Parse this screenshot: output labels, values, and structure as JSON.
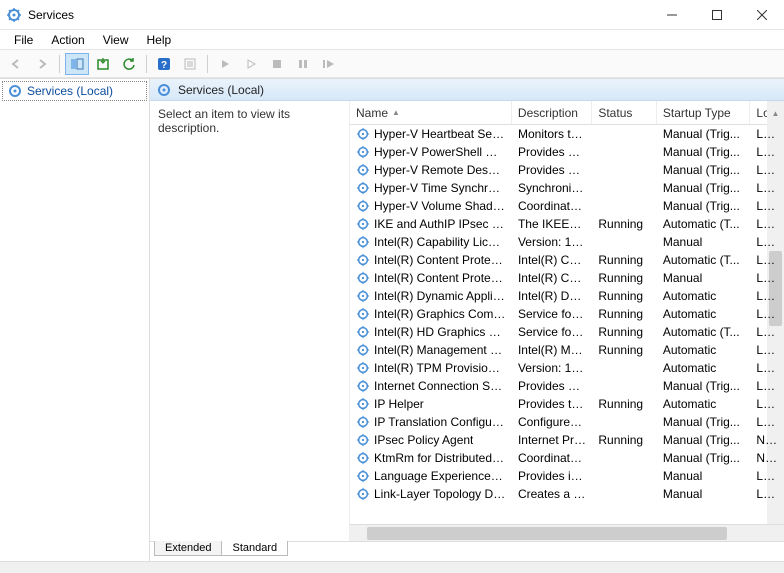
{
  "window": {
    "title": "Services"
  },
  "menu": {
    "file": "File",
    "action": "Action",
    "view": "View",
    "help": "Help"
  },
  "tree": {
    "root": "Services (Local)"
  },
  "pane": {
    "heading": "Services (Local)",
    "hint": "Select an item to view its description."
  },
  "columns": {
    "name": "Name",
    "description": "Description",
    "status": "Status",
    "startup": "Startup Type",
    "logon": "Log"
  },
  "tabs": {
    "extended": "Extended",
    "standard": "Standard"
  },
  "services": [
    {
      "name": "Hyper-V Heartbeat Service",
      "desc": "Monitors th...",
      "status": "",
      "startup": "Manual (Trig...",
      "logon": "Loca"
    },
    {
      "name": "Hyper-V PowerShell Direct ...",
      "desc": "Provides a ...",
      "status": "",
      "startup": "Manual (Trig...",
      "logon": "Loca"
    },
    {
      "name": "Hyper-V Remote Desktop Vi...",
      "desc": "Provides a p...",
      "status": "",
      "startup": "Manual (Trig...",
      "logon": "Loca"
    },
    {
      "name": "Hyper-V Time Synchronizati...",
      "desc": "Synchronize...",
      "status": "",
      "startup": "Manual (Trig...",
      "logon": "Loca"
    },
    {
      "name": "Hyper-V Volume Shadow C...",
      "desc": "Coordinates...",
      "status": "",
      "startup": "Manual (Trig...",
      "logon": "Loca"
    },
    {
      "name": "IKE and AuthIP IPsec Keying...",
      "desc": "The IKEEXT ...",
      "status": "Running",
      "startup": "Automatic (T...",
      "logon": "Loca"
    },
    {
      "name": "Intel(R) Capability Licensing...",
      "desc": "Version: 1.6...",
      "status": "",
      "startup": "Manual",
      "logon": "Loca"
    },
    {
      "name": "Intel(R) Content Protection ...",
      "desc": "Intel(R) Con...",
      "status": "Running",
      "startup": "Automatic (T...",
      "logon": "Loca"
    },
    {
      "name": "Intel(R) Content Protection ...",
      "desc": "Intel(R) Con...",
      "status": "Running",
      "startup": "Manual",
      "logon": "Loca"
    },
    {
      "name": "Intel(R) Dynamic Applicatio...",
      "desc": "Intel(R) Dyn...",
      "status": "Running",
      "startup": "Automatic",
      "logon": "Loca"
    },
    {
      "name": "Intel(R) Graphics Command...",
      "desc": "Service for I...",
      "status": "Running",
      "startup": "Automatic",
      "logon": "Loca"
    },
    {
      "name": "Intel(R) HD Graphics Contro...",
      "desc": "Service for I...",
      "status": "Running",
      "startup": "Automatic (T...",
      "logon": "Loca"
    },
    {
      "name": "Intel(R) Management and S...",
      "desc": "Intel(R) Ma...",
      "status": "Running",
      "startup": "Automatic",
      "logon": "Loca"
    },
    {
      "name": "Intel(R) TPM Provisioning S...",
      "desc": "Version: 1.6...",
      "status": "",
      "startup": "Automatic",
      "logon": "Loca"
    },
    {
      "name": "Internet Connection Sharin...",
      "desc": "Provides ne...",
      "status": "",
      "startup": "Manual (Trig...",
      "logon": "Loca"
    },
    {
      "name": "IP Helper",
      "desc": "Provides tu...",
      "status": "Running",
      "startup": "Automatic",
      "logon": "Loca"
    },
    {
      "name": "IP Translation Configuration...",
      "desc": "Configures ...",
      "status": "",
      "startup": "Manual (Trig...",
      "logon": "Loca"
    },
    {
      "name": "IPsec Policy Agent",
      "desc": "Internet Pro...",
      "status": "Running",
      "startup": "Manual (Trig...",
      "logon": "Netw"
    },
    {
      "name": "KtmRm for Distributed Tran...",
      "desc": "Coordinates...",
      "status": "",
      "startup": "Manual (Trig...",
      "logon": "Netw"
    },
    {
      "name": "Language Experience Service",
      "desc": "Provides inf...",
      "status": "",
      "startup": "Manual",
      "logon": "Loca"
    },
    {
      "name": "Link-Layer Topology Discov...",
      "desc": "Creates a N...",
      "status": "",
      "startup": "Manual",
      "logon": "Loca"
    }
  ]
}
